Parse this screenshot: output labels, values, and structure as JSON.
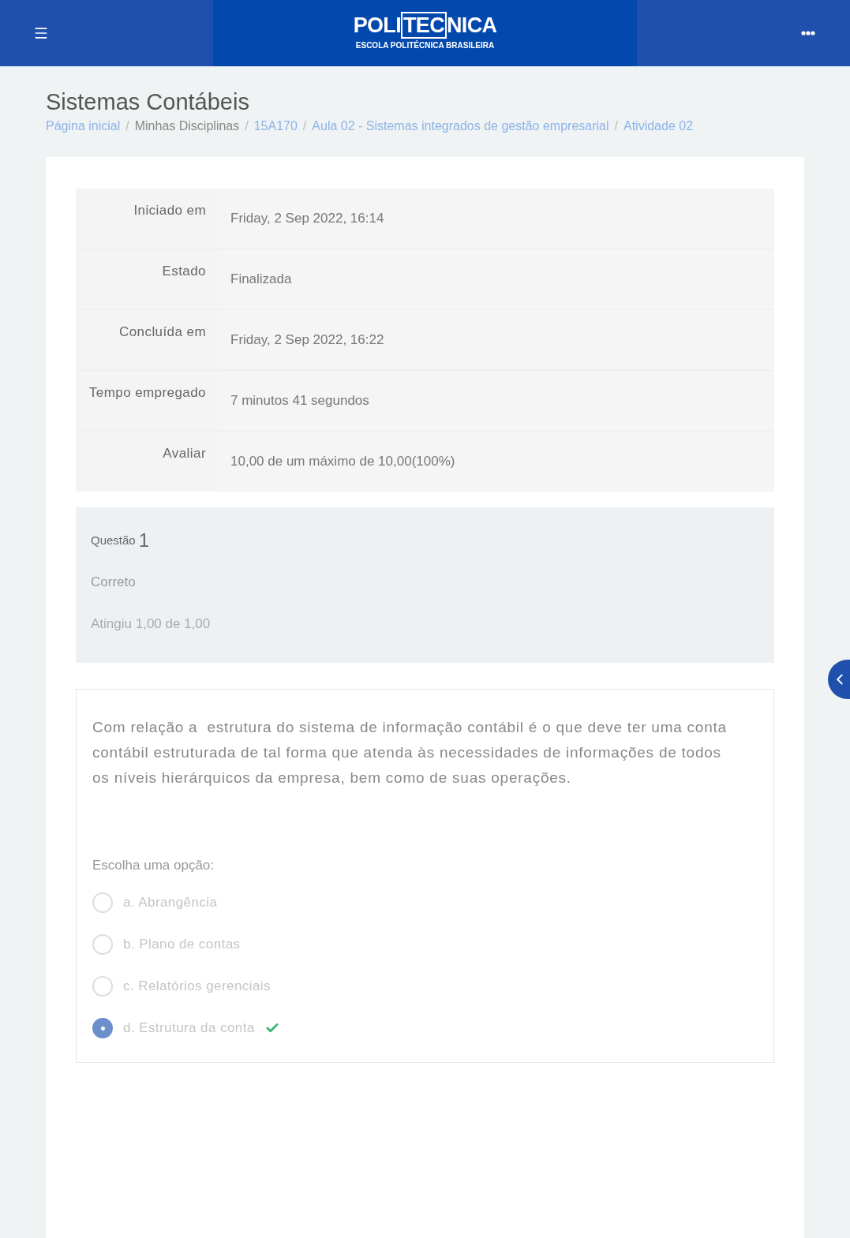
{
  "header": {
    "logo": {
      "left": "POLI",
      "boxed": "TEC",
      "right": "NICA",
      "subtitle": "ESCOLA POLITÉCNICA BRASILEIRA"
    }
  },
  "page_title": "Sistemas Contábeis",
  "breadcrumb": [
    {
      "label": "Página inicial",
      "link": true
    },
    {
      "sep": "/",
      "label": "Minhas Disciplinas",
      "link": false
    },
    {
      "sep": "/",
      "label": "15A170",
      "link": true
    },
    {
      "sep": "/",
      "label": "Aula 02 - Sistemas integrados de gestão empresarial",
      "link": true
    },
    {
      "sep": "/",
      "label": "Atividade 02",
      "link": true
    }
  ],
  "summary": [
    {
      "label": "Iniciado em",
      "value": "Friday, 2 Sep 2022, 16:14"
    },
    {
      "label": "Estado",
      "value": "Finalizada"
    },
    {
      "label": "Concluída em",
      "value": "Friday, 2 Sep 2022, 16:22"
    },
    {
      "label": "Tempo empregado",
      "value": "7 minutos 41 segundos"
    },
    {
      "label": "Avaliar",
      "value": "10,00 de um máximo de 10,00(100%)"
    }
  ],
  "question_info": {
    "label": "Questão",
    "number": "1",
    "status": "Correto",
    "score": "Atingiu 1,00 de 1,00"
  },
  "question": {
    "text": "Com relação a  estrutura do sistema de informação contábil é o que deve ter uma conta contábil estruturada de tal forma que atenda às necessidades de informações de todos os níveis hierárquicos da empresa, bem como de suas operações.",
    "prompt": "Escolha uma opção:",
    "options": [
      {
        "label": "a. Abrangência",
        "selected": false,
        "correct": false
      },
      {
        "label": "b. Plano de contas",
        "selected": false,
        "correct": false
      },
      {
        "label": "c. Relatórios gerenciais",
        "selected": false,
        "correct": false
      },
      {
        "label": "d. Estrutura da conta",
        "selected": true,
        "correct": true
      }
    ]
  }
}
